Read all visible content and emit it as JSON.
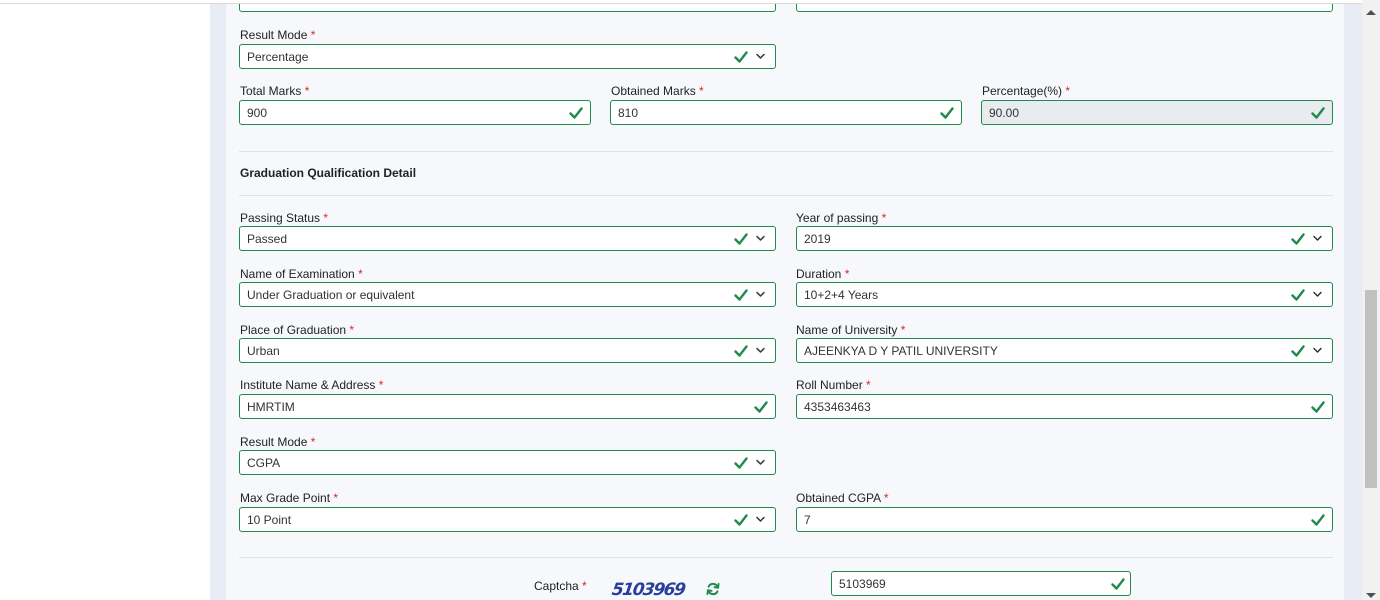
{
  "top_row": {
    "left_value": "",
    "right_value": ""
  },
  "twelfth": {
    "result_mode": {
      "label": "Result Mode",
      "value": "Percentage"
    },
    "total_marks": {
      "label": "Total Marks",
      "value": "900"
    },
    "obtained_marks": {
      "label": "Obtained Marks",
      "value": "810"
    },
    "percentage": {
      "label": "Percentage(%)",
      "value": "90.00"
    }
  },
  "graduation": {
    "title": "Graduation Qualification Detail",
    "passing_status": {
      "label": "Passing Status",
      "value": "Passed"
    },
    "year_of_passing": {
      "label": "Year of passing",
      "value": "2019"
    },
    "name_of_examination": {
      "label": "Name of Examination",
      "value": "Under Graduation or equivalent"
    },
    "duration": {
      "label": "Duration",
      "value": "10+2+4 Years"
    },
    "place_of_graduation": {
      "label": "Place of Graduation",
      "value": "Urban"
    },
    "name_of_university": {
      "label": "Name of University",
      "value": "AJEENKYA D Y PATIL UNIVERSITY"
    },
    "institute": {
      "label": "Institute Name & Address",
      "value": "HMRTIM"
    },
    "roll_number": {
      "label": "Roll Number",
      "value": "4353463463"
    },
    "result_mode": {
      "label": "Result Mode",
      "value": "CGPA"
    },
    "max_grade_point": {
      "label": "Max Grade Point",
      "value": "10 Point"
    },
    "obtained_cgpa": {
      "label": "Obtained CGPA",
      "value": "7"
    }
  },
  "captcha": {
    "label": "Captcha",
    "image_text": "5103969",
    "value": "5103969"
  },
  "required_marker": "*",
  "colors": {
    "valid_border": "#1e8a4c",
    "check": "#1e8a4c",
    "required": "#e02424"
  },
  "icons": {
    "valid": "check-icon",
    "dropdown": "chevron-down-icon",
    "refresh": "refresh-icon"
  }
}
